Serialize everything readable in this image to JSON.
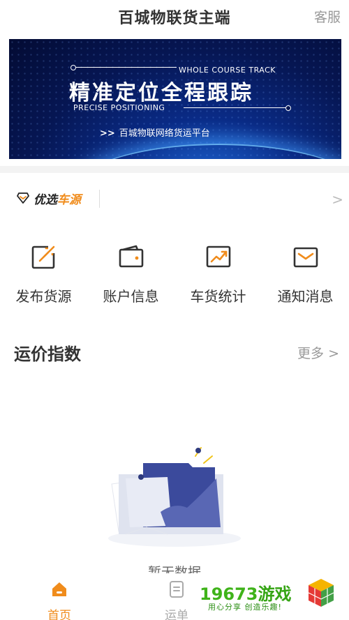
{
  "header": {
    "title": "百城物联货主端",
    "service": "客服"
  },
  "banner": {
    "en_top": "WHOLE COURSE TRACK",
    "headline": "精准定位全程跟踪",
    "en_bottom": "PRECISE POSITIONING",
    "arrows": ">>",
    "subtitle": "百城物联网络货运平台"
  },
  "preferred": {
    "label_black": "优选",
    "label_accent": "车源",
    "chevron": ">",
    "icon": "diamond-icon"
  },
  "menu": [
    {
      "label": "发布货源",
      "icon": "publish-icon"
    },
    {
      "label": "账户信息",
      "icon": "wallet-icon"
    },
    {
      "label": "车货统计",
      "icon": "chart-icon"
    },
    {
      "label": "通知消息",
      "icon": "mail-icon"
    }
  ],
  "freight_index": {
    "title": "运价指数",
    "more": "更多",
    "chevron": ">"
  },
  "empty_state": {
    "text": "暂无数据"
  },
  "tabbar": [
    {
      "label": "首页",
      "icon": "home-icon",
      "active": true
    },
    {
      "label": "运单",
      "icon": "waybill-icon",
      "active": false
    }
  ],
  "watermark": {
    "brand_num": "19673",
    "brand_text": "游戏",
    "slogan": "用心分享 创造乐趣!"
  },
  "colors": {
    "accent": "#f08c1c",
    "text": "#333333",
    "muted": "#999999",
    "banner_dark": "#061653",
    "watermark_green": "#3fb31a"
  }
}
